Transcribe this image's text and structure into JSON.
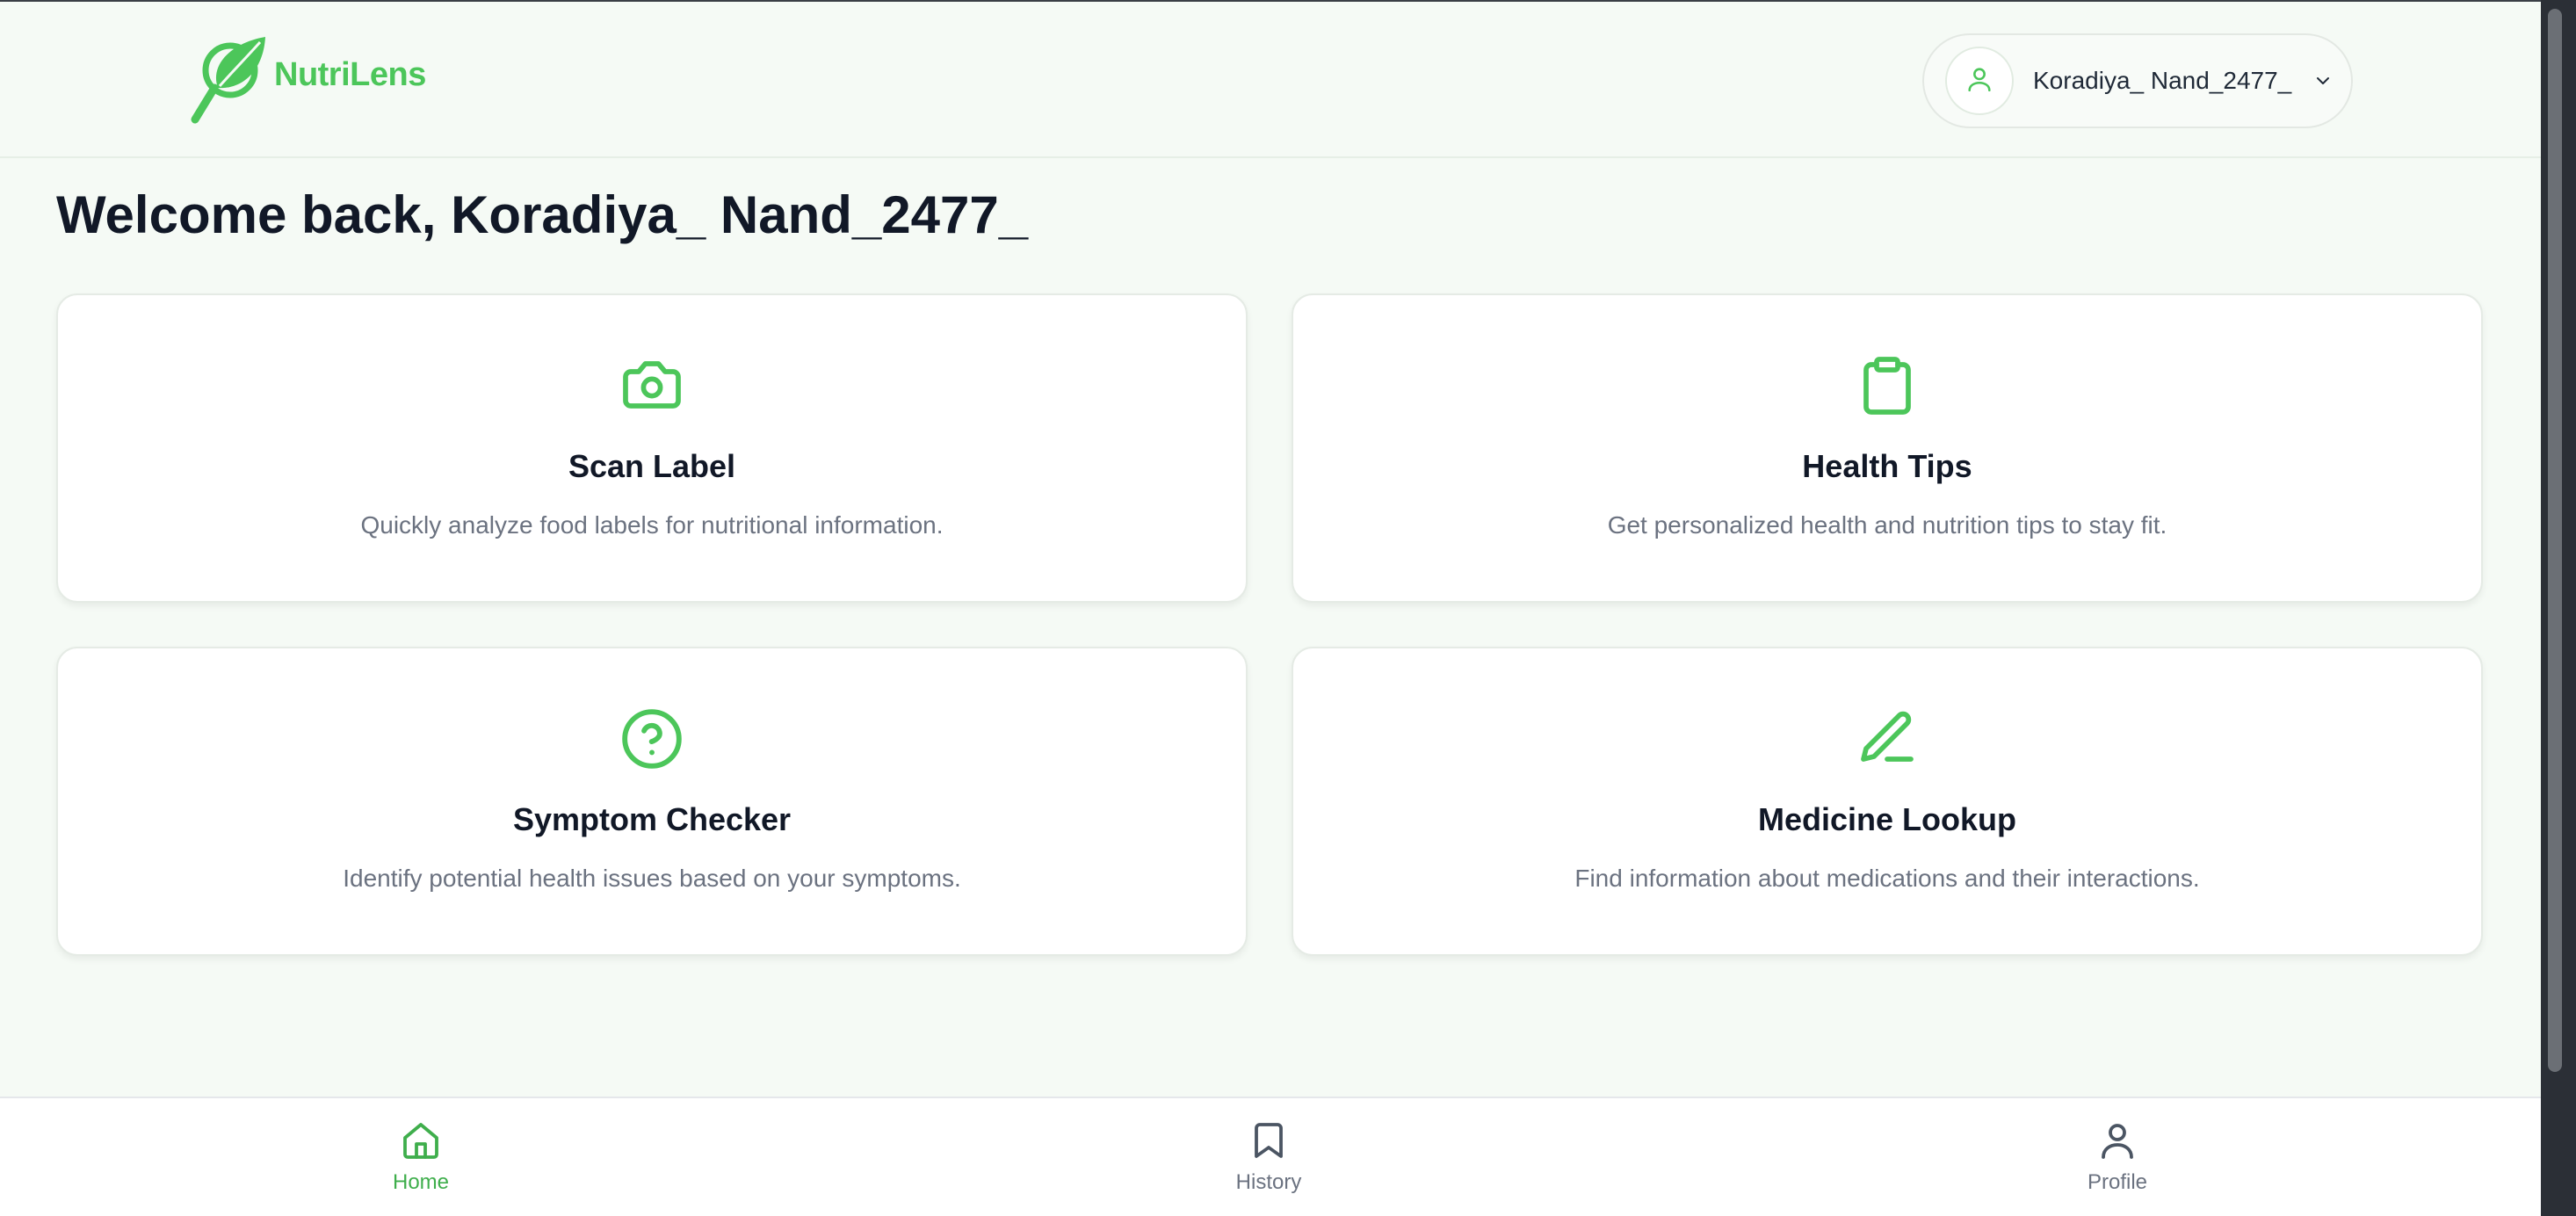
{
  "brand": {
    "name": "NutriLens",
    "accent": "#4cc65a"
  },
  "user": {
    "name": "Koradiya_ Nand_2477_"
  },
  "welcome": "Welcome back, Koradiya_ Nand_2477_",
  "cards": [
    {
      "title": "Scan Label",
      "desc": "Quickly analyze food labels for nutritional information.",
      "icon": "camera-icon"
    },
    {
      "title": "Health Tips",
      "desc": "Get personalized health and nutrition tips to stay fit.",
      "icon": "clipboard-icon"
    },
    {
      "title": "Symptom Checker",
      "desc": "Identify potential health issues based on your symptoms.",
      "icon": "help-circle-icon"
    },
    {
      "title": "Medicine Lookup",
      "desc": "Find information about medications and their interactions.",
      "icon": "pen-icon"
    }
  ],
  "nav": [
    {
      "label": "Home",
      "icon": "home-icon",
      "active": true
    },
    {
      "label": "History",
      "icon": "bookmark-icon",
      "active": false
    },
    {
      "label": "Profile",
      "icon": "user-icon",
      "active": false
    }
  ]
}
